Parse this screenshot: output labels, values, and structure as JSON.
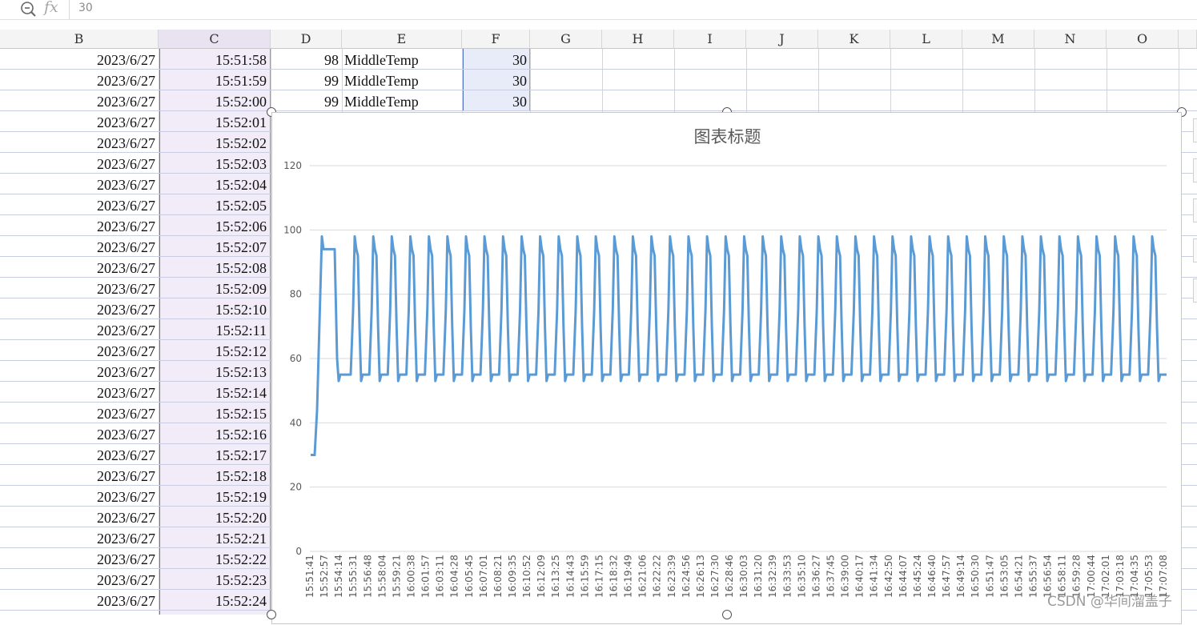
{
  "formula_bar": {
    "fx_label": "fx",
    "value": "30"
  },
  "columns": [
    "B",
    "C",
    "D",
    "E",
    "F",
    "G",
    "H",
    "I",
    "J",
    "K",
    "L",
    "M",
    "N",
    "O"
  ],
  "rows_top": [
    {
      "date": "2023/6/27",
      "time": "15:51:58",
      "d": "98",
      "e": "MiddleTemp",
      "f": "30"
    },
    {
      "date": "2023/6/27",
      "time": "15:51:59",
      "d": "99",
      "e": "MiddleTemp",
      "f": "30"
    },
    {
      "date": "2023/6/27",
      "time": "15:52:00",
      "d": "99",
      "e": "MiddleTemp",
      "f": "30"
    }
  ],
  "rows_left": [
    {
      "date": "2023/6/27",
      "time": "15:52:01"
    },
    {
      "date": "2023/6/27",
      "time": "15:52:02"
    },
    {
      "date": "2023/6/27",
      "time": "15:52:03"
    },
    {
      "date": "2023/6/27",
      "time": "15:52:04"
    },
    {
      "date": "2023/6/27",
      "time": "15:52:05"
    },
    {
      "date": "2023/6/27",
      "time": "15:52:06"
    },
    {
      "date": "2023/6/27",
      "time": "15:52:07"
    },
    {
      "date": "2023/6/27",
      "time": "15:52:08"
    },
    {
      "date": "2023/6/27",
      "time": "15:52:09"
    },
    {
      "date": "2023/6/27",
      "time": "15:52:10"
    },
    {
      "date": "2023/6/27",
      "time": "15:52:11"
    },
    {
      "date": "2023/6/27",
      "time": "15:52:12"
    },
    {
      "date": "2023/6/27",
      "time": "15:52:13"
    },
    {
      "date": "2023/6/27",
      "time": "15:52:14"
    },
    {
      "date": "2023/6/27",
      "time": "15:52:15"
    },
    {
      "date": "2023/6/27",
      "time": "15:52:16"
    },
    {
      "date": "2023/6/27",
      "time": "15:52:17"
    },
    {
      "date": "2023/6/27",
      "time": "15:52:18"
    },
    {
      "date": "2023/6/27",
      "time": "15:52:19"
    },
    {
      "date": "2023/6/27",
      "time": "15:52:20"
    },
    {
      "date": "2023/6/27",
      "time": "15:52:21"
    },
    {
      "date": "2023/6/27",
      "time": "15:52:22"
    },
    {
      "date": "2023/6/27",
      "time": "15:52:23"
    },
    {
      "date": "2023/6/27",
      "time": "15:52:24"
    }
  ],
  "chart_data": {
    "type": "line",
    "title": "图表标题",
    "xlabel": "",
    "ylabel": "",
    "ylim": [
      0,
      120
    ],
    "yticks": [
      0,
      20,
      40,
      60,
      80,
      100,
      120
    ],
    "grid": true,
    "legend": "none",
    "line_color": "#5b9bd5",
    "x_tick_labels": [
      "15:51:41",
      "15:52:57",
      "15:54:14",
      "15:55:31",
      "15:56:48",
      "15:58:04",
      "15:59:21",
      "16:00:38",
      "16:01:57",
      "16:03:11",
      "16:04:28",
      "16:05:45",
      "16:07:01",
      "16:08:21",
      "16:09:35",
      "16:10:52",
      "16:12:09",
      "16:13:25",
      "16:14:43",
      "16:15:59",
      "16:17:15",
      "16:18:32",
      "16:19:49",
      "16:21:06",
      "16:22:22",
      "16:23:39",
      "16:24:56",
      "16:26:13",
      "16:27:30",
      "16:28:46",
      "16:30:03",
      "16:31:20",
      "16:32:39",
      "16:33:53",
      "16:35:10",
      "16:36:27",
      "16:37:45",
      "16:39:00",
      "16:40:17",
      "16:41:34",
      "16:42:50",
      "16:44:07",
      "16:45:24",
      "16:46:40",
      "16:47:57",
      "16:49:14",
      "16:50:30",
      "16:51:47",
      "16:53:05",
      "16:54:21",
      "16:55:37",
      "16:56:54",
      "16:58:11",
      "16:59:28",
      "17:00:44",
      "17:02:01",
      "17:03:18",
      "17:04:35",
      "17:05:53",
      "17:07:08"
    ],
    "series": [
      {
        "values": {
          "start_level": 30,
          "warmup_plateau": 94,
          "baseline": 55,
          "peak": 98,
          "trough_dip": 53,
          "cycles": 44
        }
      }
    ]
  },
  "watermark": "CSDN @华间溜盖子"
}
